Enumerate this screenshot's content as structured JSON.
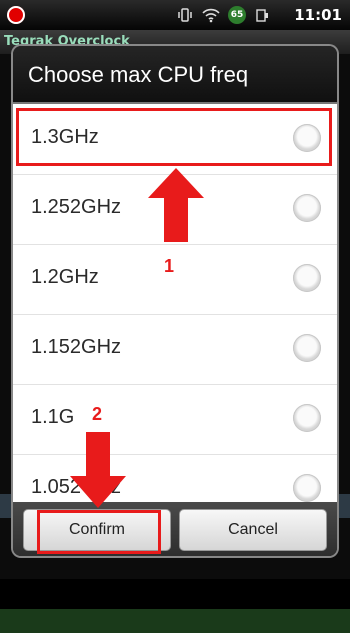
{
  "status_bar": {
    "time": "11:01",
    "battery_level": "65",
    "icons": [
      "record-icon",
      "vibrate-icon",
      "wifi-icon",
      "battery-icon"
    ]
  },
  "app": {
    "title": "Tegrak Overclock"
  },
  "dialog": {
    "title": "Choose max CPU freq",
    "options": [
      {
        "label": "1.3GHz",
        "selected": false
      },
      {
        "label": "1.252GHz",
        "selected": false
      },
      {
        "label": "1.2GHz",
        "selected": false
      },
      {
        "label": "1.152GHz",
        "selected": false
      },
      {
        "label": "1.1G",
        "selected": false
      },
      {
        "label": "1.052GHz",
        "selected": false
      }
    ],
    "confirm_label": "Confirm",
    "cancel_label": "Cancel"
  },
  "annotations": {
    "step1": "1",
    "step2": "2",
    "color": "#e81b1b"
  }
}
